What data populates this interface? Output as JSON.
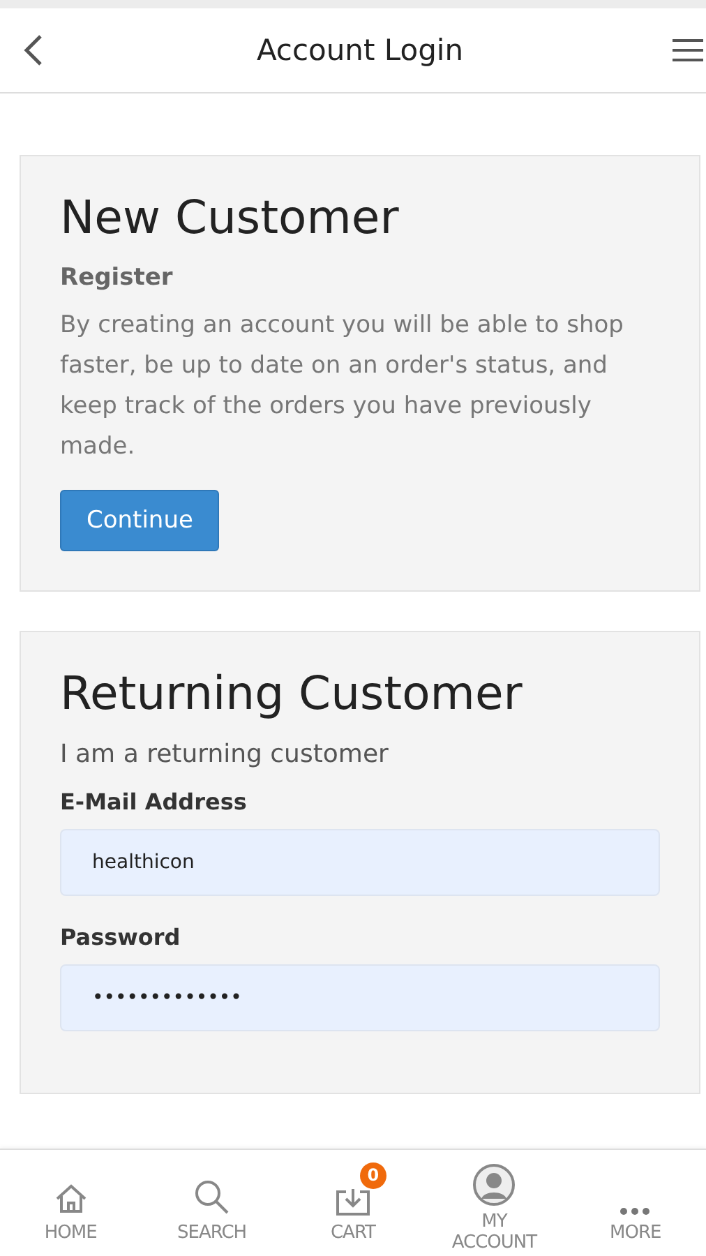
{
  "header": {
    "title": "Account Login"
  },
  "new_customer": {
    "title": "New Customer",
    "subtitle": "Register",
    "text": "By creating an account you will be able to shop faster, be up to date on an order's status, and keep track of the orders you have previously made.",
    "button": "Continue"
  },
  "returning_customer": {
    "title": "Returning Customer",
    "subtitle": "I am a returning customer",
    "fields": [
      {
        "label": "E-Mail Address",
        "value": "healthicon"
      },
      {
        "label": "Password",
        "value": "•••••••••••••"
      }
    ]
  },
  "bottom_nav": [
    {
      "kind": "home",
      "label": "HOME"
    },
    {
      "kind": "search",
      "label": "SEARCH"
    },
    {
      "kind": "cart",
      "label": "CART",
      "badge": "0"
    },
    {
      "kind": "account",
      "label": "MY ACCOUNT"
    },
    {
      "kind": "more",
      "label": "MORE"
    }
  ]
}
